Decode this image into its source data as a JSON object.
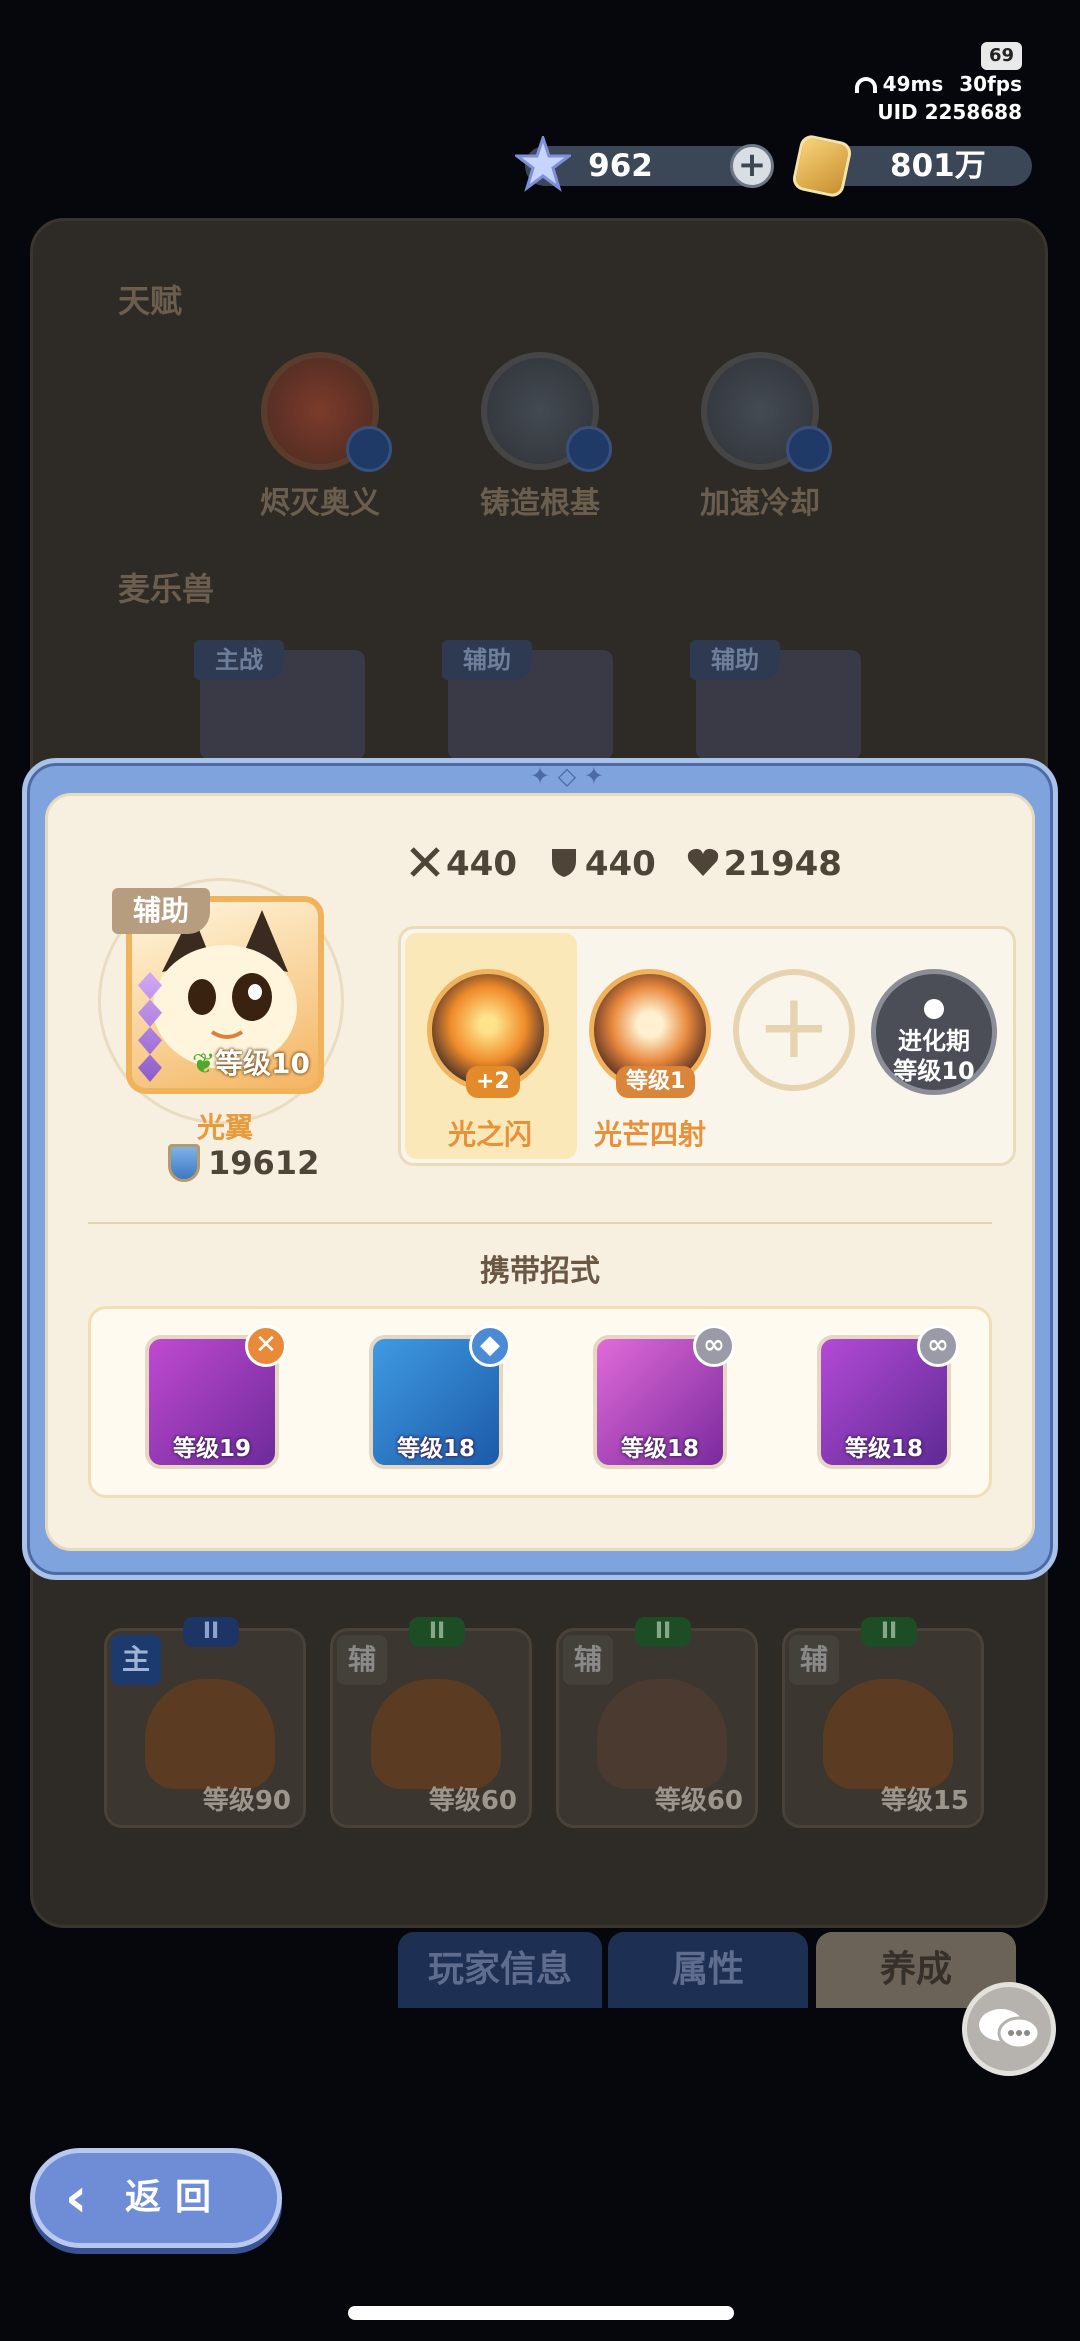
{
  "status": {
    "battery": "69",
    "ping": "49ms",
    "fps": "30fps",
    "uid": "UID 2258688"
  },
  "currency": {
    "gems": "962",
    "gold": "801万"
  },
  "background": {
    "talent_title": "天赋",
    "talents": [
      "烬灭奥义",
      "铸造根基",
      "加速冷却"
    ],
    "pets_title": "麦乐兽",
    "pet_tags": [
      "主战",
      "辅助",
      "辅助"
    ],
    "team": [
      {
        "role": "主",
        "rank": "II",
        "level": "等级90"
      },
      {
        "role": "辅",
        "rank": "II",
        "level": "等级60"
      },
      {
        "role": "辅",
        "rank": "II",
        "level": "等级60"
      },
      {
        "role": "辅",
        "rank": "II",
        "level": "等级15"
      }
    ],
    "tabs": [
      "玩家信息",
      "属性",
      "养成"
    ]
  },
  "modal": {
    "stats": {
      "attack": "440",
      "defense": "440",
      "hp": "21948"
    },
    "pet": {
      "tag": "辅助",
      "name": "光翼",
      "level": "等级10",
      "power": "19612"
    },
    "skills": [
      {
        "name": "光之闪",
        "badge": "+2"
      },
      {
        "name": "光芒四射",
        "badge": "等级1"
      }
    ],
    "locked_slot": {
      "line1": "进化期",
      "line2": "等级10"
    },
    "moves_title": "携带招式",
    "moves": [
      {
        "level": "等级19",
        "badge_icon": "cross-icon"
      },
      {
        "level": "等级18",
        "badge_icon": "shield-icon"
      },
      {
        "level": "等级18",
        "badge_icon": "swap-icon"
      },
      {
        "level": "等级18",
        "badge_icon": "swap-icon"
      }
    ]
  },
  "back_label": "返回",
  "colors": {
    "modal_frame": "#7fa3dc",
    "panel": "#f7f0e1",
    "accent_orange": "#e99a3b"
  }
}
